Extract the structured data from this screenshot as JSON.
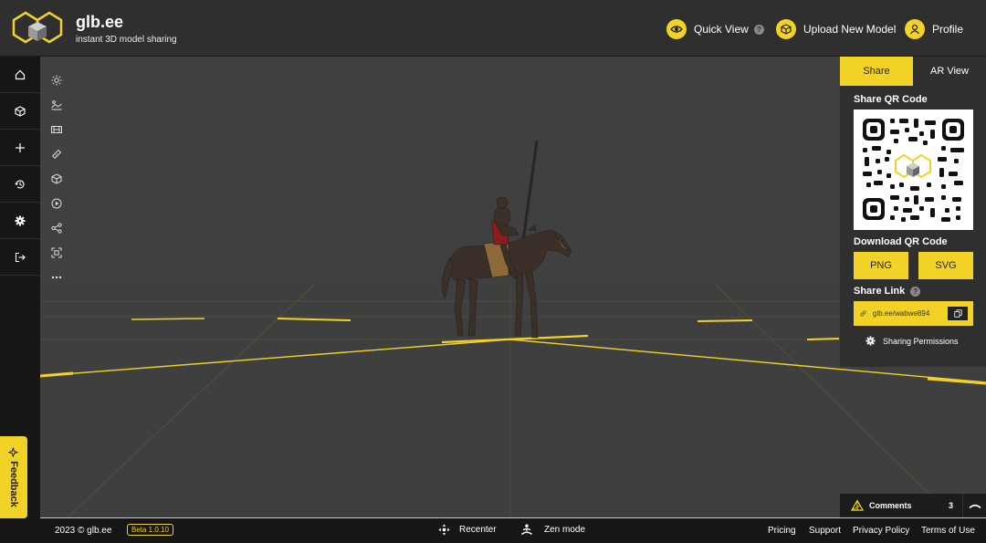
{
  "header": {
    "brand_name": "glb.ee",
    "brand_tagline": "instant 3D model sharing",
    "quick_view": "Quick View",
    "upload": "Upload New Model",
    "profile": "Profile",
    "help_glyph": "?"
  },
  "left_nav": {
    "icons": [
      "home-icon",
      "cube-icon",
      "plus-icon",
      "history-icon",
      "settings-icon",
      "logout-icon"
    ],
    "feedback": "Feedback"
  },
  "toolbar": {
    "icons": [
      "light-icon",
      "environment-icon",
      "film-icon",
      "ruler-icon",
      "model-icon",
      "play-icon",
      "share-nodes-icon",
      "frame-icon",
      "more-icon"
    ]
  },
  "panel": {
    "tab_share": "Share",
    "tab_ar": "AR View",
    "share_qr_title": "Share QR Code",
    "download_qr_title": "Download QR Code",
    "png": "PNG",
    "svg": "SVG",
    "share_link_title": "Share Link",
    "share_link_value": "glb.ee/wabwe894",
    "sharing_permissions": "Sharing Permissions"
  },
  "comments": {
    "label": "Comments",
    "count": "3"
  },
  "footer": {
    "copyright": "2023 © glb.ee",
    "beta": "Beta 1.0.10",
    "recenter": "Recenter",
    "zen_mode": "Zen mode",
    "pricing": "Pricing",
    "support": "Support",
    "privacy": "Privacy Policy",
    "terms": "Terms of Use"
  },
  "colors": {
    "accent": "#f2d227",
    "header_bg": "#2f2f2f",
    "nav_bg": "#161616",
    "viewport_bg": "#404040"
  }
}
